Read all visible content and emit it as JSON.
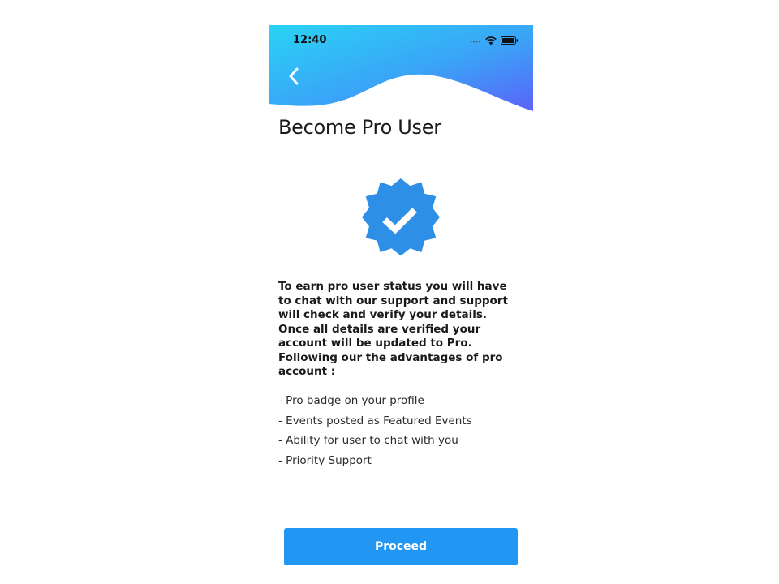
{
  "status_bar": {
    "time": "12:40"
  },
  "header": {
    "back_icon": "chevron-left-icon",
    "gradient_colors": [
      "#29d3f5",
      "#5a63f8"
    ]
  },
  "title": "Become Pro User",
  "badge": {
    "icon": "verified-badge-icon",
    "color": "#2d8fe6"
  },
  "description": "To earn pro user status you will have to chat with our support and support will check and verify your details. Once all details are verified your account will be updated to Pro. Following our the advantages of pro account :",
  "advantages": [
    "- Pro badge on your profile",
    "- Events posted as Featured Events",
    "- Ability for user to chat with you",
    "- Priority Support"
  ],
  "proceed_button": {
    "label": "Proceed",
    "color": "#2196f3"
  }
}
